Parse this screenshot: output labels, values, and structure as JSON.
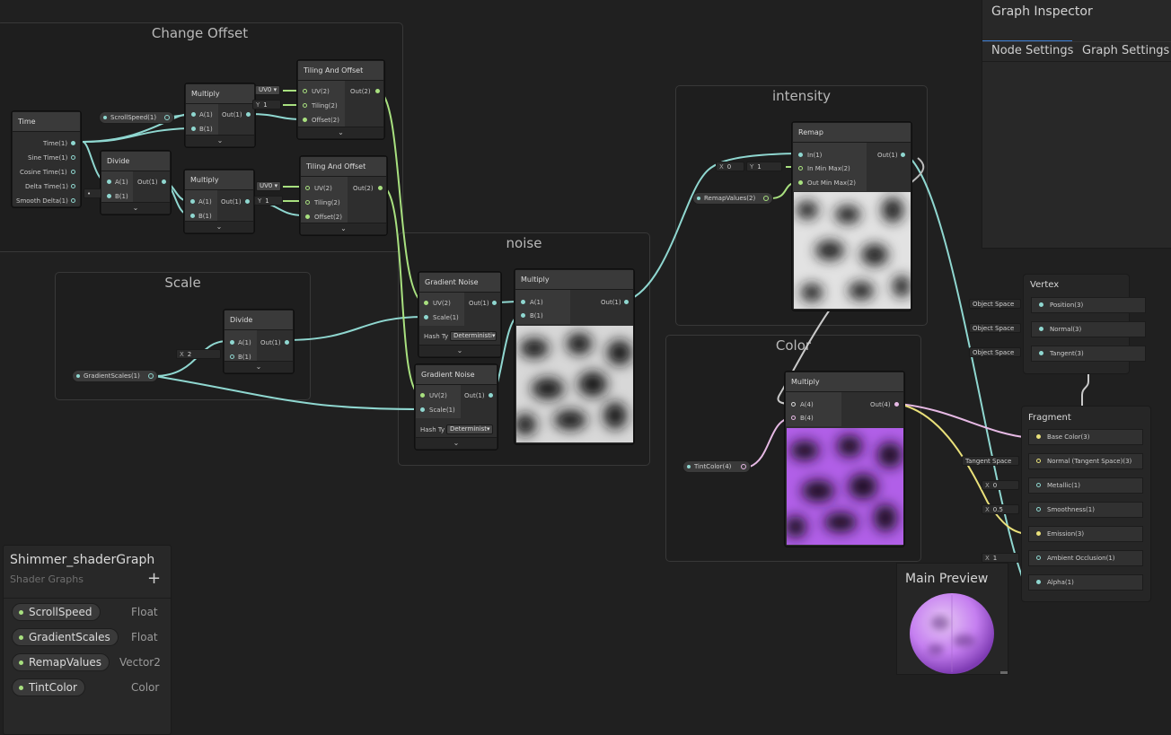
{
  "groups": {
    "change_offset": "Change Offset",
    "scale": "Scale",
    "noise": "noise",
    "intensity": "intensity",
    "color": "Color"
  },
  "time_node": {
    "title": "Time",
    "outputs": [
      "Time(1)",
      "Sine Time(1)",
      "Cosine Time(1)",
      "Delta Time(1)",
      "Smooth Delta(1)"
    ]
  },
  "divide_top": {
    "title": "Divide",
    "a": "A(1)",
    "b": "B(1)",
    "out": "Out(1)"
  },
  "multiply_top": {
    "title": "Multiply",
    "a": "A(1)",
    "b": "B(1)",
    "out": "Out(1)"
  },
  "multiply_mid": {
    "title": "Multiply",
    "a": "A(1)",
    "b": "B(1)",
    "out": "Out(1)"
  },
  "tiling_top": {
    "title": "Tiling And Offset",
    "uv": "UV(2)",
    "tiling": "Tiling(2)",
    "offset": "Offset(2)",
    "out": "Out(2)",
    "uv_value": "UV0",
    "tiling_value": "1",
    "tiling_label": "Y"
  },
  "tiling_mid": {
    "title": "Tiling And Offset",
    "uv": "UV(2)",
    "tiling": "Tiling(2)",
    "offset": "Offset(2)",
    "out": "Out(2)",
    "uv_value": "UV0",
    "tiling_value": "1",
    "tiling_label": "Y"
  },
  "scroll_pill": "ScrollSpeed(1)",
  "divide_scale": {
    "title": "Divide",
    "a": "A(1)",
    "b": "B(1)",
    "out": "Out(1)",
    "x_label": "X",
    "x_value": "2"
  },
  "gradient_scales_pill": "GradientScales(1)",
  "gradient_noise_1": {
    "title": "Gradient Noise",
    "uv": "UV(2)",
    "scale": "Scale(1)",
    "out": "Out(1)",
    "hash_label": "Hash Ty",
    "hash_value": "Deterministi"
  },
  "gradient_noise_2": {
    "title": "Gradient Noise",
    "uv": "UV(2)",
    "scale": "Scale(1)",
    "out": "Out(1)",
    "hash_label": "Hash Ty",
    "hash_value": "Determinist"
  },
  "multiply_noise": {
    "title": "Multiply",
    "a": "A(1)",
    "b": "B(1)",
    "out": "Out(1)"
  },
  "remap": {
    "title": "Remap",
    "in": "In(1)",
    "in_min_max": "In Min Max(2)",
    "out_min_max": "Out Min Max(2)",
    "out": "Out(1)",
    "x_label": "X",
    "x_value": "0",
    "y_label": "Y",
    "y_value": "1"
  },
  "remap_pill": "RemapValues(2)",
  "multiply_color": {
    "title": "Multiply",
    "a": "A(4)",
    "b": "B(4)",
    "out": "Out(4)"
  },
  "tint_pill": "TintColor(4)",
  "vertex": {
    "title": "Vertex",
    "ports": [
      {
        "label": "Position(3)",
        "space": "Object Space"
      },
      {
        "label": "Normal(3)",
        "space": "Object Space"
      },
      {
        "label": "Tangent(3)",
        "space": "Object Space"
      }
    ]
  },
  "fragment": {
    "title": "Fragment",
    "ports": [
      {
        "label": "Base Color(3)",
        "input": ""
      },
      {
        "label": "Normal (Tangent Space)(3)",
        "input": "Tangent Space"
      },
      {
        "label": "Metallic(1)",
        "input": "0",
        "input_label": "X"
      },
      {
        "label": "Smoothness(1)",
        "input": "0.5",
        "input_label": "X"
      },
      {
        "label": "Emission(3)",
        "input": ""
      },
      {
        "label": "Ambient Occlusion(1)",
        "input": "1",
        "input_label": "X"
      },
      {
        "label": "Alpha(1)",
        "input": ""
      }
    ]
  },
  "inspector": {
    "title": "Graph Inspector",
    "tabs": [
      "Node Settings",
      "Graph Settings"
    ]
  },
  "main_preview": {
    "title": "Main Preview"
  },
  "blackboard": {
    "title": "Shimmer_shaderGraph",
    "subtitle": "Shader Graphs",
    "add": "+",
    "properties": [
      {
        "name": "ScrollSpeed",
        "type": "Float"
      },
      {
        "name": "GradientScales",
        "type": "Float"
      },
      {
        "name": "RemapValues",
        "type": "Vector2"
      },
      {
        "name": "TintColor",
        "type": "Color"
      }
    ]
  },
  "colors": {
    "wire_float": "#8fd7d0",
    "wire_vec2": "#a8e07f",
    "wire_vec4": "#e6b9e4",
    "wire_vec3": "#e9e07a",
    "accent_tab": "#3d7fd6",
    "tint_purple": "#b15fe8"
  }
}
